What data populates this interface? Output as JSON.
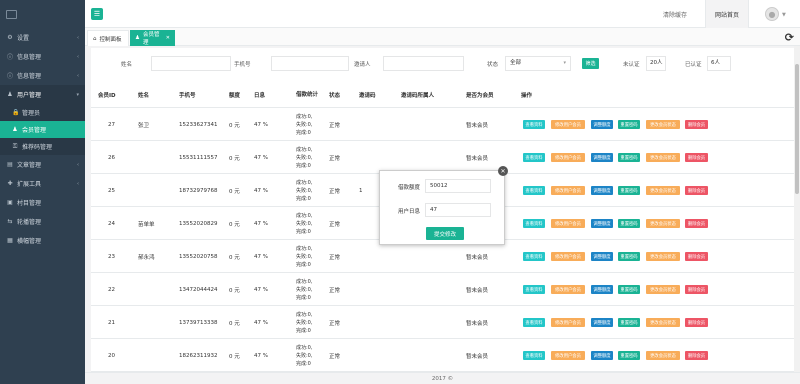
{
  "sidebar": {
    "menu": [
      {
        "icon": "gear-icon",
        "label": "设置",
        "open": false
      },
      {
        "icon": "info-icon",
        "label": "信息管理",
        "open": false
      },
      {
        "icon": "info-icon",
        "label": "信息管理",
        "open": false
      },
      {
        "icon": "user-icon",
        "label": "用户管理",
        "open": true
      }
    ],
    "submenu": [
      {
        "icon": "lock-icon",
        "label": "管理员",
        "active": false
      },
      {
        "icon": "person-icon",
        "label": "会员管理",
        "active": true
      },
      {
        "icon": "key-icon",
        "label": "推荐码管理",
        "active": false
      }
    ],
    "menu2": [
      {
        "icon": "doc-icon",
        "label": "文章管理"
      },
      {
        "icon": "tools-icon",
        "label": "扩展工具"
      },
      {
        "icon": "bag-icon",
        "label": "村目管理"
      },
      {
        "icon": "carousel-icon",
        "label": "轮播管理"
      },
      {
        "icon": "grid-icon",
        "label": "横幅管理"
      }
    ]
  },
  "topbar": {
    "menu_toggle_icon": "hamburger-icon",
    "clear_cache": "清除缓存",
    "site_home": "网站首页"
  },
  "tabs": [
    {
      "icon": "home-icon",
      "label": "控制面板",
      "active": false
    },
    {
      "icon": "person-icon",
      "label": "会员管理",
      "active": true
    }
  ],
  "filters": {
    "name_label": "姓名",
    "phone_label": "手机号",
    "inviter_label": "邀请人",
    "status_label": "状态",
    "status_value": "全部",
    "filter_button": "筛选",
    "unverified_label": "未认证",
    "unverified_count": "20人",
    "verified_label": "已认证",
    "verified_count": "6人"
  },
  "table": {
    "headers": [
      "会员ID",
      "姓名",
      "手机号",
      "额度",
      "日息",
      "借款统计",
      "状态",
      "邀请码",
      "邀请码所属人",
      "是否为会员",
      "操作"
    ],
    "actions": [
      "查看资料",
      "修改用户会员",
      "调整额度",
      "重置密码",
      "更改会员状态",
      "删除会员"
    ],
    "rows": [
      {
        "id": "27",
        "name": "张卫",
        "phone": "15233627341",
        "amount": "0 元",
        "rate": "47 %",
        "stats": [
          "成功:0,",
          "失败:0,",
          "完成:0"
        ],
        "status": "正常",
        "code": "",
        "owner": "",
        "member": "暂未会员",
        "actions": true
      },
      {
        "id": "26",
        "name": "",
        "phone": "15531111557",
        "amount": "0 元",
        "rate": "47 %",
        "stats": [
          "成功:0,",
          "失败:0,",
          "完成:0"
        ],
        "status": "正常",
        "code": "",
        "owner": "",
        "member": "暂未会员",
        "actions": true
      },
      {
        "id": "25",
        "name": "",
        "phone": "18732979768",
        "amount": "0 元",
        "rate": "47 %",
        "stats": [
          "成功:0,",
          "失败:0,",
          "完成:0"
        ],
        "status": "正常",
        "code": "1",
        "owner": "",
        "member": "",
        "actions": true
      },
      {
        "id": "24",
        "name": "苗单单",
        "phone": "13552020829",
        "amount": "0 元",
        "rate": "47 %",
        "stats": [
          "成功:0,",
          "失败:0,",
          "完成:0"
        ],
        "status": "正常",
        "code": "",
        "owner": "",
        "member": "",
        "actions": true
      },
      {
        "id": "23",
        "name": "郝永鸿",
        "phone": "13552020758",
        "amount": "0 元",
        "rate": "47 %",
        "stats": [
          "成功:0,",
          "失败:0,",
          "完成:0"
        ],
        "status": "正常",
        "code": "",
        "owner": "",
        "member": "暂未会员",
        "actions": true
      },
      {
        "id": "22",
        "name": "",
        "phone": "13472044424",
        "amount": "0 元",
        "rate": "47 %",
        "stats": [
          "成功:0,",
          "失败:0,",
          "完成:0"
        ],
        "status": "正常",
        "code": "",
        "owner": "",
        "member": "暂未会员",
        "actions": true
      },
      {
        "id": "21",
        "name": "",
        "phone": "13739713338",
        "amount": "0 元",
        "rate": "47 %",
        "stats": [
          "成功:0,",
          "失败:0,",
          "完成:0"
        ],
        "status": "正常",
        "code": "",
        "owner": "",
        "member": "暂未会员",
        "actions": true
      },
      {
        "id": "20",
        "name": "",
        "phone": "18262311932",
        "amount": "0 元",
        "rate": "47 %",
        "stats": [
          "成功:0,",
          "失败:0,",
          "完成:0"
        ],
        "status": "正常",
        "code": "",
        "owner": "",
        "member": "暂未会员",
        "actions": true
      }
    ]
  },
  "modal": {
    "limit_label": "借款额度",
    "limit_value": "50012",
    "rate_label": "用户日息",
    "rate_value": "47",
    "submit": "提交修改",
    "close_icon": "close-icon"
  },
  "footer": {
    "text": "2017 ©"
  },
  "colors": {
    "sidebar": "#2f4050",
    "accent": "#1ab394",
    "info": "#23c6c8",
    "warning": "#f8ac59",
    "primary": "#1c84c6",
    "danger": "#ed5565"
  }
}
